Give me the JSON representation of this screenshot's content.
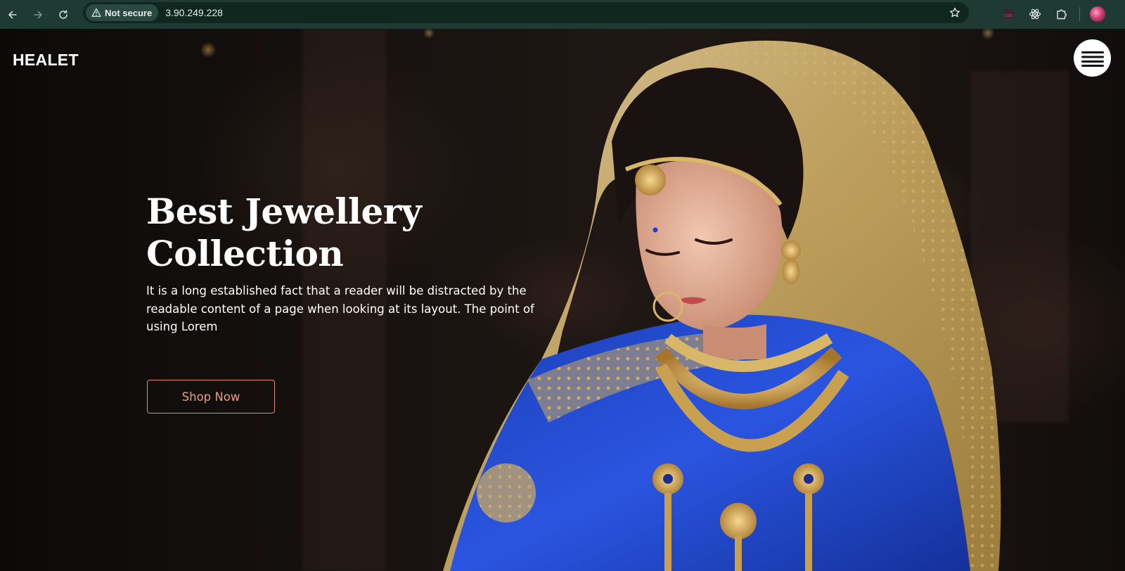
{
  "browser": {
    "security_label": "Not secure",
    "url": "3.90.249.228",
    "icons": [
      "back-arrow-icon",
      "forward-arrow-icon",
      "reload-icon",
      "warning-triangle-icon",
      "bookmark-star-icon",
      "css-extension-icon",
      "react-devtools-icon",
      "extensions-puzzle-icon",
      "profile-avatar"
    ]
  },
  "site": {
    "brand": "HEALET",
    "menu_icon": "hamburger-menu-icon"
  },
  "hero": {
    "title_line1": "Best Jewellery",
    "title_line2": "Collection",
    "description": "It is a long established fact that a reader will be distracted by the readable content of a page when looking at its layout. The point of using Lorem",
    "cta_label": "Shop Now"
  },
  "colors": {
    "browser_bar": "#1f3a33",
    "omnibox": "#10271f",
    "hero_bg": "#14100e",
    "cta_accent": "#f29a7c",
    "text": "#ffffff"
  }
}
